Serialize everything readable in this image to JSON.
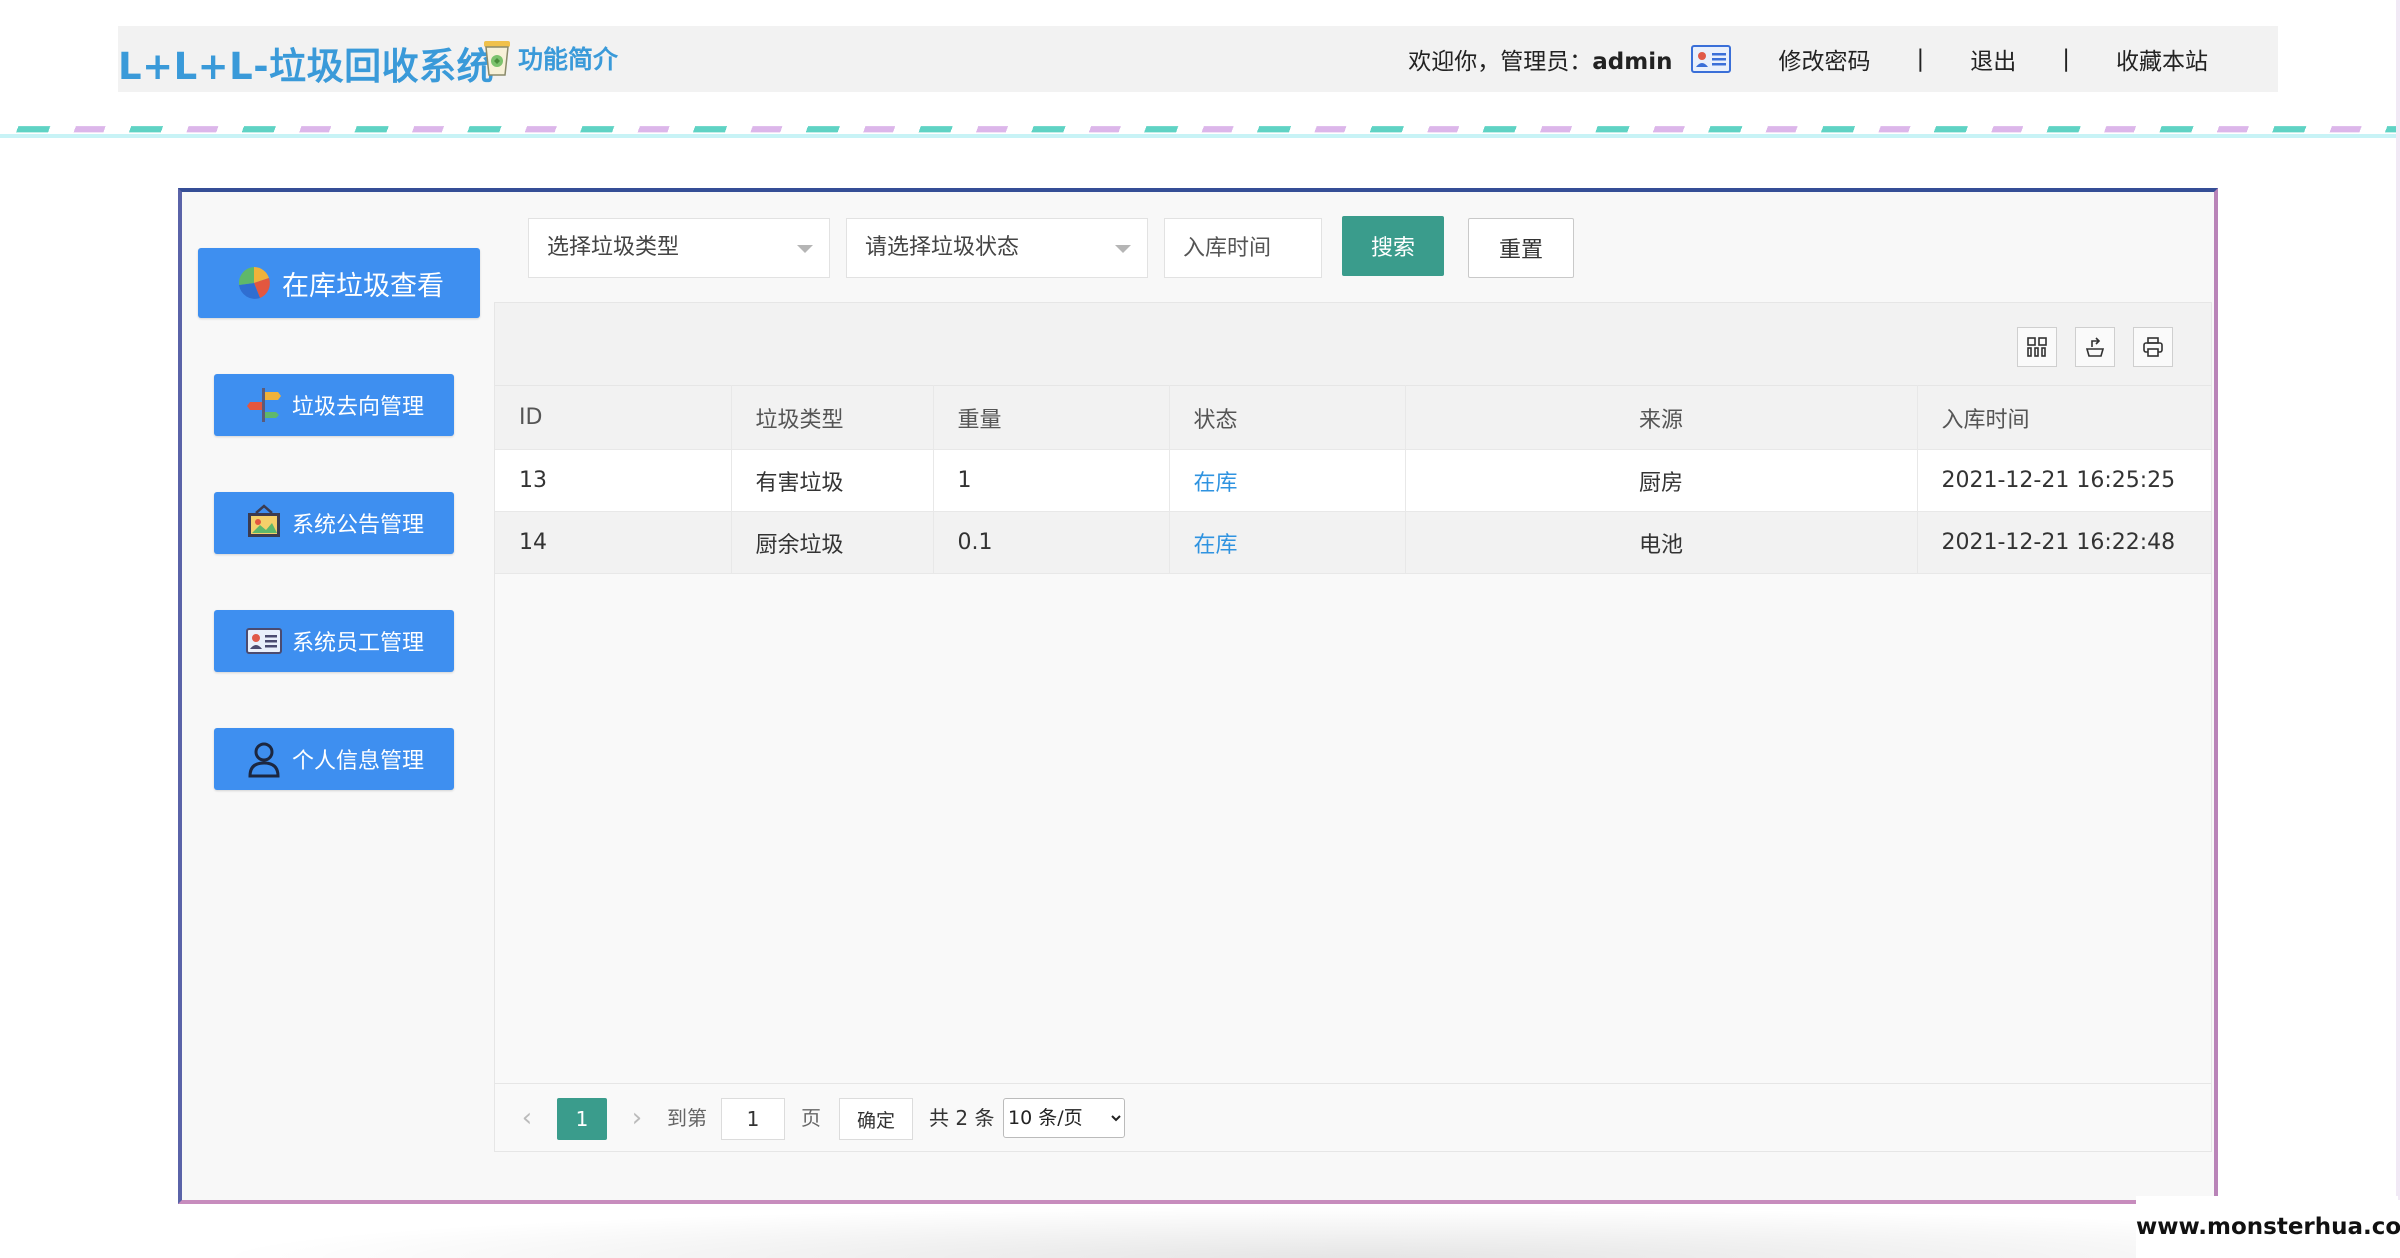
{
  "header": {
    "title": "L+L+L-垃圾回收系统",
    "intro_label": "功能简介",
    "welcome_prefix": "欢迎你，管理员：",
    "username": "admin",
    "change_password": "修改密码",
    "separator": "|",
    "logout": "退出",
    "bookmark": "收藏本站"
  },
  "sidebar": {
    "main_button": "在库垃圾查看",
    "items": [
      {
        "label": "垃圾去向管理",
        "icon": "signpost-icon"
      },
      {
        "label": "系统公告管理",
        "icon": "bulletin-icon"
      },
      {
        "label": "系统员工管理",
        "icon": "id-card-icon"
      },
      {
        "label": "个人信息管理",
        "icon": "user-icon"
      }
    ]
  },
  "filters": {
    "type_placeholder": "选择垃圾类型",
    "status_placeholder": "请选择垃圾状态",
    "date_placeholder": "入库时间",
    "search": "搜索",
    "reset": "重置"
  },
  "table": {
    "columns": [
      "ID",
      "垃圾类型",
      "重量",
      "状态",
      "来源",
      "入库时间"
    ],
    "rows": [
      {
        "id": "13",
        "type": "有害垃圾",
        "weight": "1",
        "status": "在库",
        "source": "厨房",
        "time": "2021-12-21 16:25:25"
      },
      {
        "id": "14",
        "type": "厨余垃圾",
        "weight": "0.1",
        "status": "在库",
        "source": "电池",
        "time": "2021-12-21 16:22:48"
      }
    ]
  },
  "pager": {
    "current": "1",
    "goto_label": "到第",
    "goto_value": "1",
    "page_unit": "页",
    "confirm": "确定",
    "total": "共 2 条",
    "page_size": "10 条/页"
  },
  "watermark": "www.monsterhua.com",
  "colors": {
    "brand": "#3a9ad9",
    "sidebar_button": "#3e8ff0",
    "primary": "#3a9c8c",
    "status_link": "#2f93e0"
  }
}
